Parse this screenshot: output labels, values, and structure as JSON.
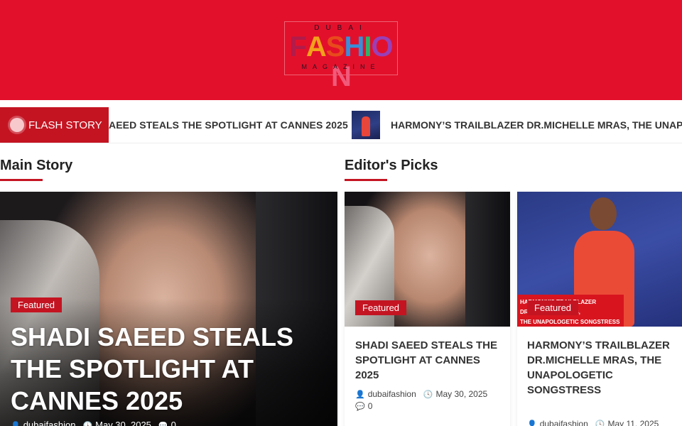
{
  "header": {
    "logo": {
      "top": "DUBAI",
      "main": "FASHION",
      "bottom": "MAGAZINE"
    },
    "logo_colors": [
      "#b21b4a",
      "#f2a21b",
      "#e84a1c",
      "#3a8ed8",
      "#2fb36b",
      "#9a3fb6",
      "#f15a7a"
    ]
  },
  "ticker": {
    "flash_label": "FLASH STORY",
    "items": [
      {
        "text": "AEED STEALS THE SPOTLIGHT AT CANNES 2025"
      },
      {
        "text": "HARMONY’S TRAILBLAZER DR.MICHELLE MRAS, THE UNAPOLO"
      }
    ]
  },
  "sections": {
    "main_story": "Main Story",
    "editors_picks": "Editor's Picks"
  },
  "main_story": {
    "badge": "Featured",
    "title": "SHADI SAEED STEALS THE SPOTLIGHT AT CANNES 2025",
    "author": "dubaifashion",
    "date": "May 30, 2025",
    "comments": "0"
  },
  "picks": [
    {
      "badge": "Featured",
      "title": "SHADI SAEED STEALS THE SPOTLIGHT AT CANNES 2025",
      "author": "dubaifashion",
      "date": "May 30, 2025",
      "comments": "0"
    },
    {
      "badge": "Featured",
      "title": "HARMONY’S TRAILBLAZER DR.MICHELLE MRAS, THE UNAPOLOGETIC SONGSTRESS",
      "banner_line1": "HARMONY’S TRAILBLAZER",
      "banner_line2": "DR. MICHELLE MRAS,",
      "banner_line3": "THE UNAPOLOGETIC SONGSTRESS",
      "author": "dubaifashion",
      "date": "May 11, 2025"
    }
  ],
  "colors": {
    "brand_red": "#e3102b",
    "accent": "#c41422"
  }
}
